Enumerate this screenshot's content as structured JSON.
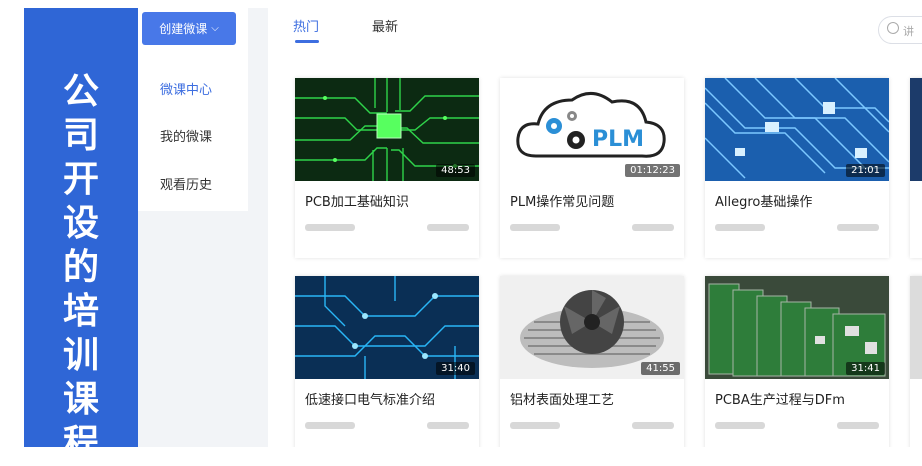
{
  "side_title": [
    "公",
    "司",
    "开",
    "设",
    "的",
    "培",
    "训",
    "课",
    "程"
  ],
  "sidebar": {
    "create_button": "创建微课",
    "items": [
      {
        "label": "微课中心",
        "active": true
      },
      {
        "label": "我的微课",
        "active": false
      },
      {
        "label": "观看历史",
        "active": false
      }
    ]
  },
  "tabs": [
    {
      "label": "热门",
      "active": true
    },
    {
      "label": "最新",
      "active": false
    }
  ],
  "search": {
    "placeholder": "讲"
  },
  "courses": [
    {
      "title": "PCB加工基础知识",
      "duration": "48:53",
      "theme": "green-pcb"
    },
    {
      "title": "PLM操作常见问题",
      "duration": "01:12:23",
      "theme": "plm-cloud",
      "logo_text": "PLM"
    },
    {
      "title": "Allegro基础操作",
      "duration": "21:01",
      "theme": "blue-pcb"
    },
    {
      "title": "低速接口电气标准介绍",
      "duration": "31:40",
      "theme": "blue-circuit"
    },
    {
      "title": "铝材表面处理工艺",
      "duration": "41:55",
      "theme": "cpu-fan"
    },
    {
      "title": "PCBA生产过程与DFm",
      "duration": "31:41",
      "theme": "pcba-boards"
    }
  ],
  "colors": {
    "accent": "#3d6ee0",
    "frame": "#2f66d6"
  }
}
